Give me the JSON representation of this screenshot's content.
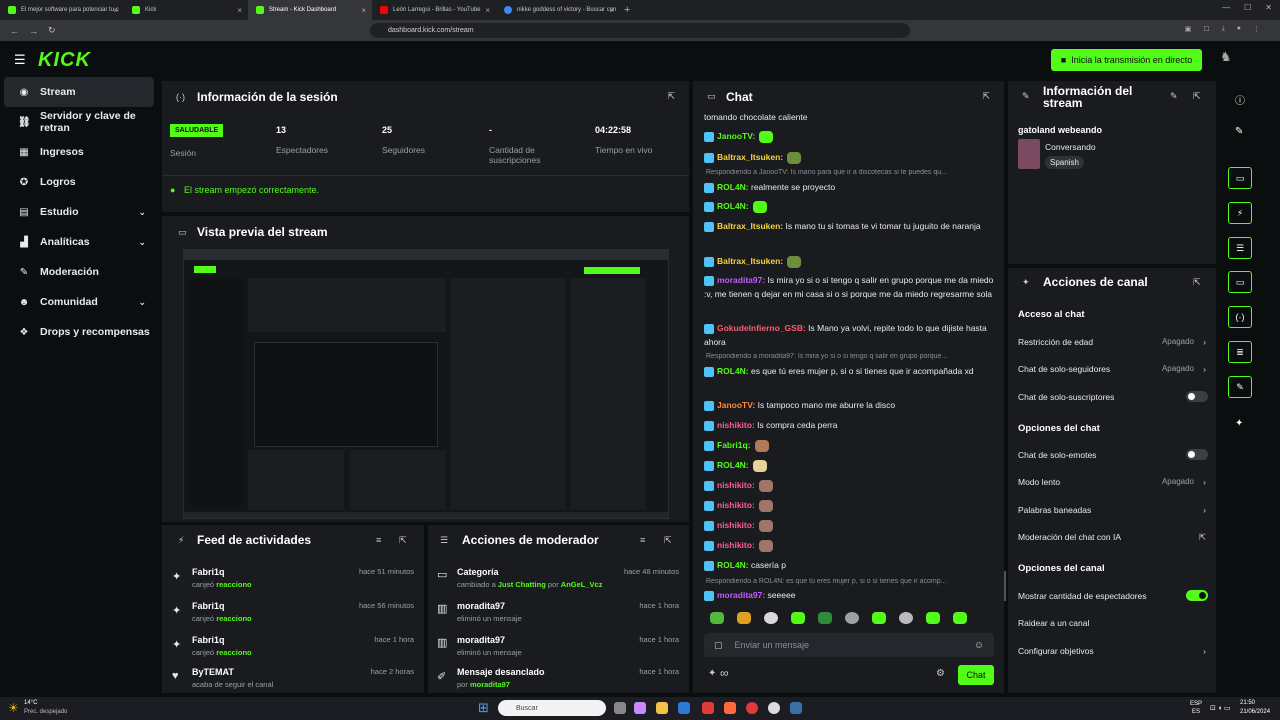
{
  "browser": {
    "tabs": [
      {
        "label": "El mejor software para potenciar tu c",
        "color": "#53fc18"
      },
      {
        "label": "Kick",
        "color": "#53fc18"
      },
      {
        "label": "Stream - Kick Dashboard",
        "color": "#53fc18",
        "active": true
      },
      {
        "label": "León Larregui - Brillas - YouTube",
        "color": "#ff0000"
      },
      {
        "label": "nikke goddess of victory - Buscar con",
        "color": "#4285f4"
      }
    ],
    "url": "dashboard.kick.com/stream"
  },
  "header": {
    "logo": "KICK",
    "live_button": "Inicia la transmisión en directo"
  },
  "sidebar": {
    "items": [
      {
        "label": "Stream",
        "icon": "record-icon"
      },
      {
        "label": "Servidor y clave de retran",
        "icon": "link-icon"
      },
      {
        "label": "Ingresos",
        "icon": "grid-icon"
      },
      {
        "label": "Logros",
        "icon": "trophy-icon"
      },
      {
        "label": "Estudio",
        "icon": "studio-icon"
      },
      {
        "label": "Analíticas",
        "icon": "chart-icon"
      },
      {
        "label": "Moderación",
        "icon": "wrench-icon"
      },
      {
        "label": "Comunidad",
        "icon": "people-icon"
      },
      {
        "label": "Drops y recompensas",
        "icon": "gift-icon"
      }
    ]
  },
  "session": {
    "title": "Información de la sesión",
    "status_badge": "SALUDABLE",
    "stats": [
      {
        "value": "",
        "label": "Sesión"
      },
      {
        "value": "13",
        "label": "Espectadores"
      },
      {
        "value": "25",
        "label": "Seguidores"
      },
      {
        "value": "-",
        "label": "Cantidad de suscripciones"
      },
      {
        "value": "04:22:58",
        "label": "Tiempo en vivo"
      }
    ],
    "ok_message": "El stream empezó correctamente."
  },
  "preview": {
    "title": "Vista previa del stream"
  },
  "activity": {
    "title": "Feed de actividades",
    "rows": [
      {
        "name": "Fabri1q",
        "action": "canjeó",
        "target": "reacciono",
        "time": "hace 51 minutos"
      },
      {
        "name": "Fabri1q",
        "action": "canjeó",
        "target": "reacciono",
        "time": "hace 56 minutos"
      },
      {
        "name": "Fabri1q",
        "action": "canjeó",
        "target": "reacciono",
        "time": "hace 1 hora"
      },
      {
        "name": "ByTEMAT",
        "action": "acaba de seguir el canal",
        "target": "",
        "time": "hace 2 horas"
      }
    ]
  },
  "modactions": {
    "title": "Acciones de moderador",
    "rows": [
      {
        "name": "Categoría",
        "sub": "cambiado a ",
        "sub2": "Just Chatting",
        "sub3": " por ",
        "sub4": "AnGeL_Vcz",
        "time": "hace 48 minutos"
      },
      {
        "name": "moradita97",
        "sub": "eliminó un mensaje",
        "time": "hace 1 hora"
      },
      {
        "name": "moradita97",
        "sub": "eliminó un mensaje",
        "time": "hace 1 hora"
      },
      {
        "name": "Mensaje desanclado",
        "sub": "por ",
        "sub2": "moradita97",
        "time": "hace 1 hora"
      }
    ]
  },
  "chat": {
    "title": "Chat",
    "input_placeholder": "Enviar un mensaje",
    "send_label": "Chat",
    "infinity": "∞",
    "messages": [
      {
        "user": "",
        "text": "tomando chocolate caliente",
        "color": "#e8eaed"
      },
      {
        "user": "JanooTV:",
        "text": "",
        "color": "#53fc18"
      },
      {
        "user": "Baltrax_Itsuken:",
        "text": "",
        "color": "#f5d442"
      },
      {
        "reply": "Respondiendo a JanooTV: Is mano para que ir a discotecas si te puedes qu..."
      },
      {
        "user": "ROL4N:",
        "text": " realmente se proyecto",
        "color": "#53fc18"
      },
      {
        "user": "ROL4N:",
        "text": "",
        "color": "#53fc18"
      },
      {
        "user": "Baltrax_Itsuken:",
        "text": " Is mano tu si tomas te vi tomar tu juguito de naranja",
        "color": "#f5d442"
      },
      {
        "user": "Baltrax_Itsuken:",
        "text": "",
        "color": "#f5d442"
      },
      {
        "user": "moradita97:",
        "text": " Is mira yo si o si tengo q salir en grupo porque me da miedo :v, me tienen q dejar en mi casa si o si porque me da miedo regresarme sola",
        "color": "#c05cff"
      },
      {
        "user": "GokudeInfierno_GSB:",
        "text": " Is Mano ya volvi, repite todo lo que dijiste hasta ahora",
        "color": "#ff5a6e"
      },
      {
        "reply": "Respondiendo a moradita97: Is mira yo si o si tengo q salir en grupo porque..."
      },
      {
        "user": "ROL4N:",
        "text": " es que tú eres mujer p, si o si tienes que ir acompañada xd",
        "color": "#53fc18"
      },
      {
        "user": "JanooTV:",
        "text": " Is tampoco mano me aburre la disco",
        "color": "#ff8a3d"
      },
      {
        "user": "nishikito:",
        "text": " Is compra ceda perra",
        "color": "#ff5a9e"
      },
      {
        "user": "Fabri1q:",
        "text": "",
        "color": "#53fc18"
      },
      {
        "user": "ROL4N:",
        "text": "",
        "color": "#53fc18"
      },
      {
        "user": "nishikito:",
        "text": "",
        "color": "#ff5a9e"
      },
      {
        "user": "nishikito:",
        "text": "",
        "color": "#ff5a9e"
      },
      {
        "user": "nishikito:",
        "text": "",
        "color": "#ff5a9e"
      },
      {
        "user": "nishikito:",
        "text": "",
        "color": "#ff5a9e"
      },
      {
        "user": "ROL4N:",
        "text": " casería p",
        "color": "#53fc18"
      },
      {
        "reply": "Respondiendo a ROL4N: es que tú eres mujer p, si o si tienes que ir acomp..."
      },
      {
        "user": "moradita97:",
        "text": " seeeee",
        "color": "#c05cff"
      }
    ]
  },
  "stream_info": {
    "title": "Información del stream",
    "stream_title": "gatoland webeando",
    "category": "Conversando",
    "language": "Spanish"
  },
  "channel_actions": {
    "title": "Acciones de canal",
    "sections": [
      {
        "heading": "Acceso al chat",
        "items": [
          {
            "label": "Restricción de edad",
            "value": "Apagado",
            "type": "arrow"
          },
          {
            "label": "Chat de solo-seguidores",
            "value": "Apagado",
            "type": "arrow"
          },
          {
            "label": "Chat de solo-suscriptores",
            "value": "",
            "type": "toggle-off"
          }
        ]
      },
      {
        "heading": "Opciones del chat",
        "items": [
          {
            "label": "Chat de solo-emotes",
            "value": "",
            "type": "toggle-off"
          },
          {
            "label": "Modo lento",
            "value": "Apagado",
            "type": "arrow"
          },
          {
            "label": "Palabras baneadas",
            "value": "",
            "type": "arrow"
          },
          {
            "label": "Moderación del chat con IA",
            "value": "",
            "type": "external"
          }
        ]
      },
      {
        "heading": "Opciones del canal",
        "items": [
          {
            "label": "Mostrar cantidad de espectadores",
            "value": "",
            "type": "toggle-on"
          },
          {
            "label": "Raidear a un canal",
            "value": "",
            "type": "none"
          },
          {
            "label": "Configurar objetivos",
            "value": "",
            "type": "arrow"
          }
        ]
      }
    ]
  },
  "taskbar": {
    "weather_temp": "14°C",
    "weather_desc": "Prec. despejado",
    "search": "Buscar",
    "lang": "ESP",
    "lang2": "ES",
    "time": "21:50",
    "date": "21/06/2024"
  },
  "colors": {
    "accent": "#53fc18",
    "panel": "#191b1f",
    "bg": "#0b0e0f"
  }
}
